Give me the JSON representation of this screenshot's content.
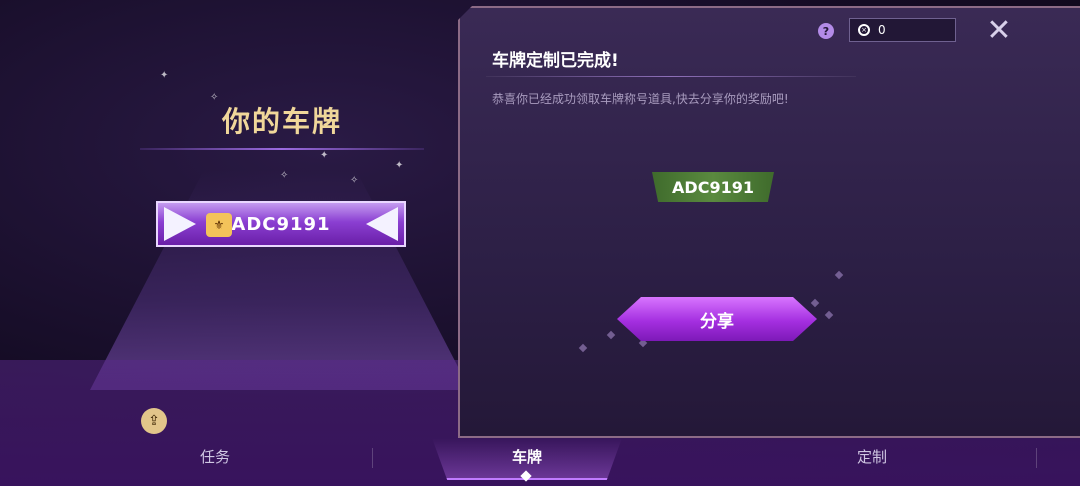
{
  "left": {
    "title": "你的车牌",
    "plate_text": "ADC9191"
  },
  "panel": {
    "title": "车牌定制已完成!",
    "subtitle": "恭喜你已经成功领取车牌称号道具,快去分享你的奖励吧!",
    "help_symbol": "?",
    "currency_value": "0",
    "close_symbol": "✕",
    "plate_text": "ADC9191",
    "share_label": "分享"
  },
  "tabs": [
    {
      "label": "任务"
    },
    {
      "label": "车牌"
    },
    {
      "label": "定制"
    }
  ],
  "colors": {
    "accent": "#a42fe0",
    "title_gold": "#f0d79a",
    "green_plate": "#5a8a3f"
  }
}
